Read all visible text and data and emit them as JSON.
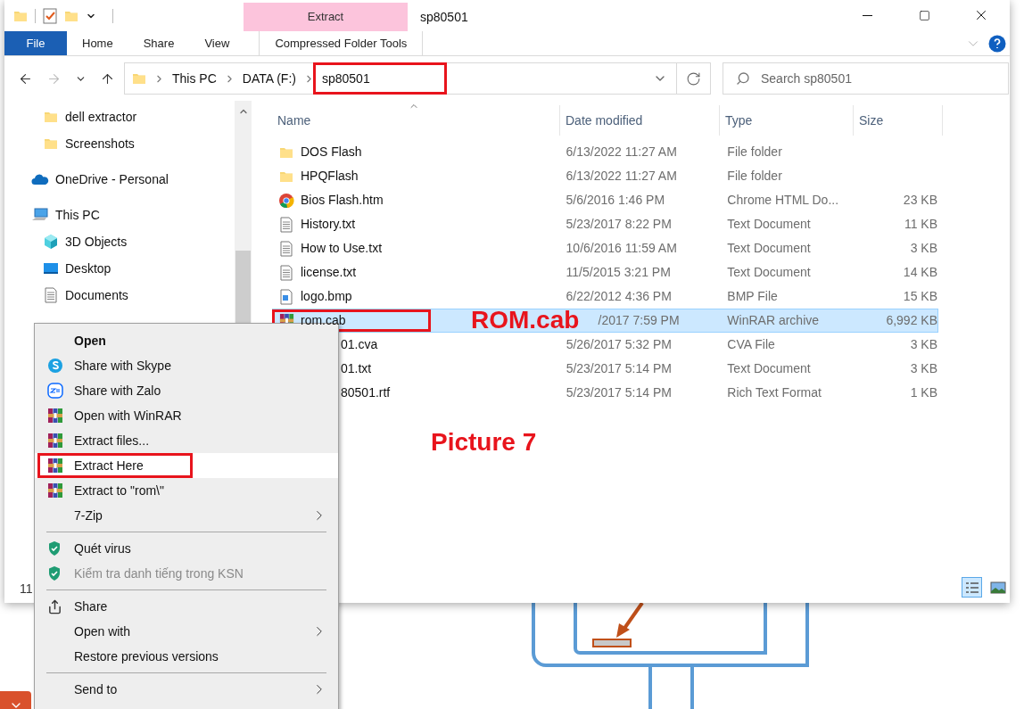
{
  "window": {
    "title": "sp80501"
  },
  "ribbon": {
    "context_group": "Extract",
    "tabs": [
      {
        "label": "File",
        "kind": "file"
      },
      {
        "label": "Home",
        "kind": "plain"
      },
      {
        "label": "Share",
        "kind": "plain"
      },
      {
        "label": "View",
        "kind": "plain"
      },
      {
        "label": "Compressed Folder Tools",
        "kind": "context"
      }
    ]
  },
  "address": {
    "segments": [
      "This PC",
      "DATA (F:)",
      "sp80501"
    ],
    "current_marked": true
  },
  "search": {
    "placeholder": "Search sp80501"
  },
  "sidebar": {
    "items": [
      {
        "children": [
          {
            "label": "dell extractor",
            "kind": "folder"
          },
          {
            "label": "Screenshots",
            "kind": "folder"
          }
        ]
      },
      {
        "label": "OneDrive - Personal",
        "kind": "cloud"
      },
      {
        "label": "This PC",
        "kind": "pc",
        "children": [
          {
            "label": "3D Objects",
            "kind": "cube"
          },
          {
            "label": "Desktop",
            "kind": "desktop"
          },
          {
            "label": "Documents",
            "kind": "document"
          }
        ]
      }
    ],
    "partial_text": "11"
  },
  "file_list": {
    "columns": [
      "Name",
      "Date modified",
      "Type",
      "Size"
    ],
    "rows": [
      {
        "name": "DOS Flash",
        "date": "6/13/2022 11:27 AM",
        "type": "File folder",
        "kind": "folder",
        "selected": false,
        "marked": false
      },
      {
        "name": "HPQFlash",
        "date": "6/13/2022 11:27 AM",
        "type": "File folder",
        "kind": "folder",
        "selected": false,
        "marked": false
      },
      {
        "name": "Bios Flash.htm",
        "date": "5/6/2016 1:46 PM",
        "type": "Chrome HTML Do...",
        "size": "23 KB",
        "kind": "chrome",
        "selected": false,
        "marked": false
      },
      {
        "name": "History.txt",
        "date": "5/23/2017 8:22 PM",
        "type": "Text Document",
        "size": "11 KB",
        "kind": "text",
        "selected": false,
        "marked": false
      },
      {
        "name": "How to Use.txt",
        "date": "10/6/2016 11:59 AM",
        "type": "Text Document",
        "size": "3 KB",
        "kind": "text",
        "selected": false,
        "marked": false
      },
      {
        "name": "license.txt",
        "date": "11/5/2015 3:21 PM",
        "type": "Text Document",
        "size": "14 KB",
        "kind": "text",
        "selected": false,
        "marked": false
      },
      {
        "name": "logo.bmp",
        "date": "6/22/2012 4:36 PM",
        "type": "BMP File",
        "size": "15 KB",
        "kind": "image",
        "selected": false,
        "marked": false
      },
      {
        "name": "rom.cab",
        "date": "/2017 7:59 PM",
        "type": "WinRAR archive",
        "size": "6,992 KB",
        "kind": "winrar",
        "selected": true,
        "marked": true,
        "callout": "ROM.cab"
      },
      {
        "name": "01.cva",
        "date": "5/26/2017 5:32 PM",
        "type": "CVA File",
        "size": "3 KB",
        "kind": "hidden",
        "selected": false,
        "marked": false
      },
      {
        "name": "01.txt",
        "date": "5/23/2017 5:14 PM",
        "type": "Text Document",
        "size": "3 KB",
        "kind": "hidden",
        "selected": false,
        "marked": false
      },
      {
        "name": "80501.rtf",
        "date": "5/23/2017 5:14 PM",
        "type": "Rich Text Format",
        "size": "1 KB",
        "kind": "hidden",
        "selected": false,
        "marked": false
      }
    ]
  },
  "view_buttons": [
    {
      "kind": "details",
      "selected": true
    },
    {
      "kind": "large-icons",
      "selected": false
    }
  ],
  "context_menu": {
    "groups": [
      [
        {
          "label": "Open",
          "kind": "none",
          "default": true,
          "disabled": false,
          "submenu": false,
          "selected": false,
          "marked": false
        },
        {
          "label": "Share with Skype",
          "kind": "skype",
          "default": false,
          "disabled": false,
          "submenu": false,
          "selected": false,
          "marked": false
        },
        {
          "label": "Share with Zalo",
          "kind": "zalo",
          "default": false,
          "disabled": false,
          "submenu": false,
          "selected": false,
          "marked": false
        },
        {
          "label": "Open with WinRAR",
          "kind": "winrar",
          "default": false,
          "disabled": false,
          "submenu": false,
          "selected": false,
          "marked": false
        },
        {
          "label": "Extract files...",
          "kind": "winrar",
          "default": false,
          "disabled": false,
          "submenu": false,
          "selected": false,
          "marked": false
        },
        {
          "label": "Extract Here",
          "kind": "winrar",
          "default": false,
          "disabled": false,
          "submenu": false,
          "selected": true,
          "marked": true
        },
        {
          "label": "Extract to \"rom\\\"",
          "kind": "winrar",
          "default": false,
          "disabled": false,
          "submenu": false,
          "selected": false,
          "marked": false
        },
        {
          "label": "7-Zip",
          "kind": "none",
          "default": false,
          "disabled": false,
          "submenu": true,
          "selected": false,
          "marked": false
        }
      ],
      [
        {
          "label": "Quét virus",
          "kind": "shield",
          "default": false,
          "disabled": false,
          "submenu": false,
          "selected": false,
          "marked": false
        },
        {
          "label": "Kiểm tra danh tiếng trong KSN",
          "kind": "shield",
          "default": false,
          "disabled": true,
          "submenu": false,
          "selected": false,
          "marked": false
        }
      ],
      [
        {
          "label": "Share",
          "kind": "share",
          "default": false,
          "disabled": false,
          "submenu": false,
          "selected": false,
          "marked": false
        },
        {
          "label": "Open with",
          "kind": "none",
          "default": false,
          "disabled": false,
          "submenu": true,
          "selected": false,
          "marked": false
        },
        {
          "label": "Restore previous versions",
          "kind": "none",
          "default": false,
          "disabled": false,
          "submenu": false,
          "selected": false,
          "marked": false
        }
      ],
      [
        {
          "label": "Send to",
          "kind": "none",
          "default": false,
          "disabled": false,
          "submenu": true,
          "selected": false,
          "marked": false
        }
      ]
    ]
  },
  "caption": "Picture 7"
}
